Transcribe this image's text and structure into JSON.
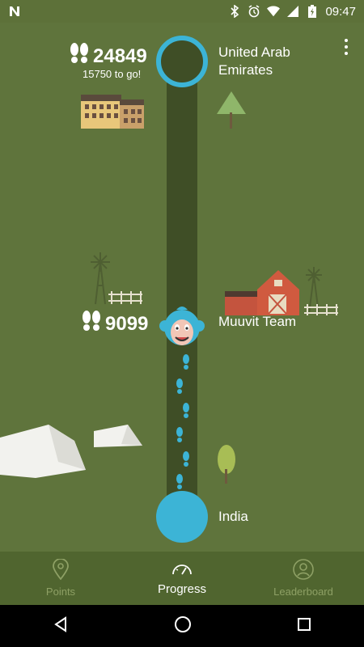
{
  "status_bar": {
    "time": "09:47",
    "icons": [
      "n-notification-icon",
      "bluetooth-icon",
      "alarm-icon",
      "wifi-icon",
      "signal-icon",
      "battery-charging-icon"
    ]
  },
  "progress": {
    "destination": {
      "name": "United Arab Emirates",
      "steps": "24849",
      "remaining": "15750 to go!"
    },
    "team": {
      "name": "Muuvit Team",
      "steps": "9099"
    },
    "origin": {
      "name": "India"
    }
  },
  "bottom_nav": {
    "items": [
      {
        "label": "Points",
        "icon": "map-pin-icon",
        "active": false
      },
      {
        "label": "Progress",
        "icon": "speedometer-icon",
        "active": true
      },
      {
        "label": "Leaderboard",
        "icon": "user-icon",
        "active": false
      }
    ]
  },
  "colors": {
    "background": "#5f743c",
    "road": "#3f4e26",
    "accent": "#3cb4d6",
    "nav_bar": "#50652f"
  }
}
